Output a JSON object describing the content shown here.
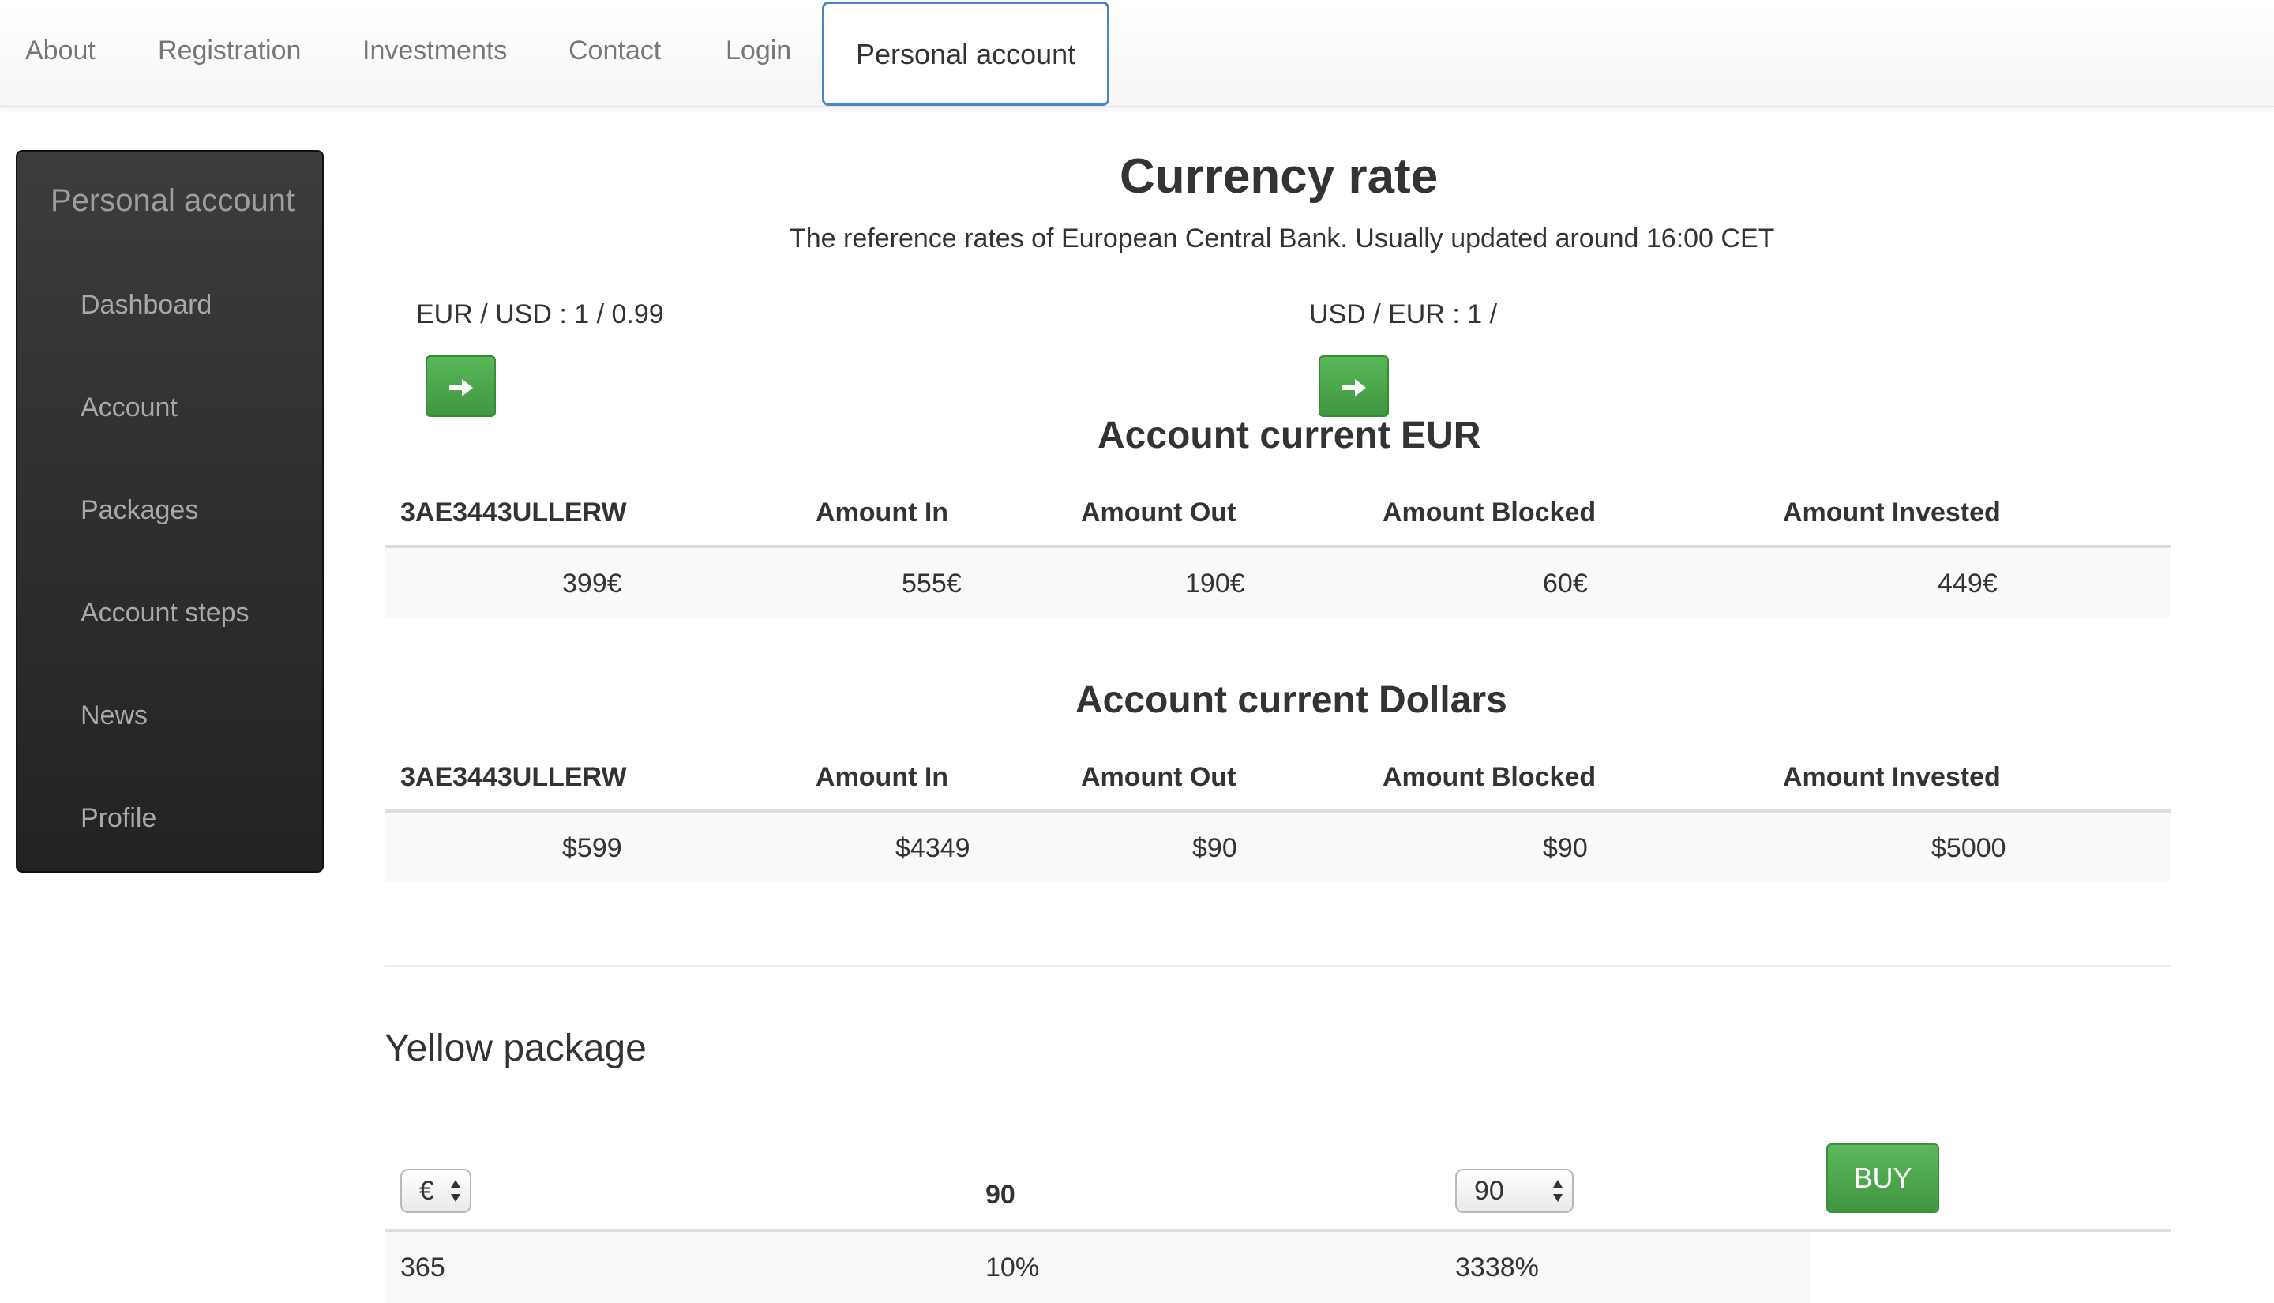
{
  "nav": {
    "items": [
      {
        "label": "About"
      },
      {
        "label": "Registration"
      },
      {
        "label": "Investments"
      },
      {
        "label": "Contact"
      },
      {
        "label": "Login"
      },
      {
        "label": "Personal account",
        "active": true
      }
    ]
  },
  "sidebar": {
    "title": "Personal account",
    "items": [
      {
        "label": "Dashboard"
      },
      {
        "label": "Account"
      },
      {
        "label": "Packages"
      },
      {
        "label": "Account steps"
      },
      {
        "label": "News"
      },
      {
        "label": "Profile"
      }
    ]
  },
  "currency": {
    "title": "Currency rate",
    "subtitle": "The reference rates of European Central Bank. Usually updated around 16:00 CET",
    "eur_usd": "EUR / USD : 1 / 0.99",
    "usd_eur": "USD / EUR : 1 /",
    "arrow_icon": "arrow-right-icon"
  },
  "account_eur": {
    "title": "Account current EUR",
    "headers": [
      "3AE3443ULLERW",
      "Amount In",
      "Amount Out",
      "Amount Blocked",
      "Amount Invested"
    ],
    "values": [
      "399€",
      "555€",
      "190€",
      "60€",
      "449€"
    ]
  },
  "account_usd": {
    "title": "Account current Dollars",
    "headers": [
      "3AE3443ULLERW",
      "Amount In",
      "Amount Out",
      "Amount Blocked",
      "Amount Invested"
    ],
    "values": [
      "$599",
      "$4349",
      "$90",
      "$90",
      "$5000"
    ]
  },
  "package": {
    "title": "Yellow package",
    "currency_select": "€",
    "header_value": "90",
    "days_select": "90",
    "buy_label": "BUY",
    "row": [
      "365",
      "10%",
      "3338%"
    ]
  },
  "colors": {
    "button_green": "#5cb85c",
    "active_tab_border": "#4a86c5",
    "sidebar_bg": "#2b2b2b"
  }
}
